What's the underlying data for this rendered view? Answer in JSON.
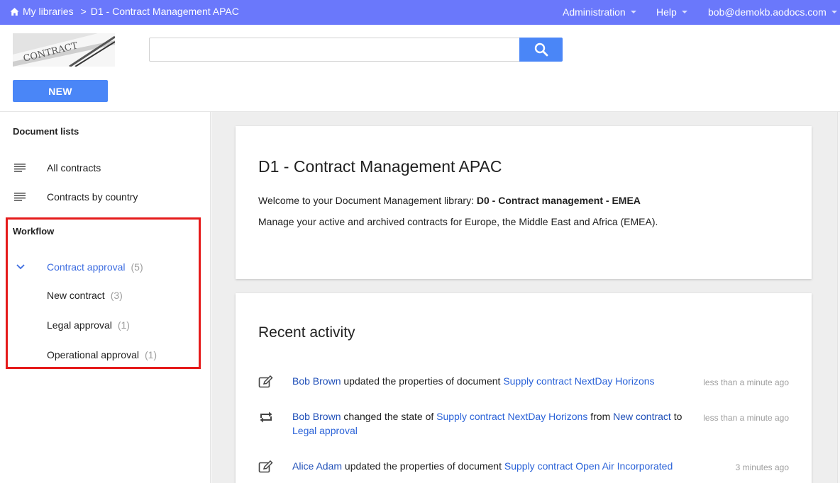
{
  "topbar": {
    "home_label": "My libraries",
    "separator": ">",
    "current_library": "D1 - Contract Management APAC",
    "menu": {
      "administration": "Administration",
      "help": "Help",
      "account": "bob@demokb.aodocs.com"
    },
    "accent_color": "#6a78fb"
  },
  "header": {
    "logo_text": "CONTRACT",
    "search_placeholder": "",
    "new_button": "NEW"
  },
  "sidebar": {
    "document_lists_heading": "Document lists",
    "document_lists": [
      {
        "label": "All contracts",
        "icon": "list-icon"
      },
      {
        "label": "Contracts by country",
        "icon": "list-icon"
      }
    ],
    "workflow_heading": "Workflow",
    "workflow": {
      "label": "Contract approval",
      "count": "(5)",
      "expanded": true,
      "states": [
        {
          "label": "New contract",
          "count": "(3)"
        },
        {
          "label": "Legal approval",
          "count": "(1)"
        },
        {
          "label": "Operational approval",
          "count": "(1)"
        }
      ]
    }
  },
  "library_card": {
    "title": "D1 - Contract Management APAC",
    "welcome_prefix": "Welcome to your Document Management library: ",
    "welcome_library": "D0 - Contract management - EMEA",
    "description": "Manage your active and archived contracts for Europe, the Middle East and Africa (EMEA)."
  },
  "recent_activity": {
    "title": "Recent activity",
    "items": [
      {
        "icon": "edit-icon",
        "user": "Bob Brown",
        "action": " updated the properties of document ",
        "document": "Supply contract NextDay Horizons",
        "time": "less than a minute ago"
      },
      {
        "icon": "state-change-icon",
        "user": "Bob Brown",
        "action": " changed the state of ",
        "document": "Supply contract NextDay Horizons",
        "from_word": " from ",
        "from_state": "New contract",
        "to_word": " to ",
        "to_state": "Legal approval",
        "time": "less than a minute ago"
      },
      {
        "icon": "edit-icon",
        "user": "Alice Adam",
        "action": " updated the properties of document ",
        "document": "Supply contract Open Air Incorporated",
        "time": "3 minutes ago"
      }
    ]
  }
}
